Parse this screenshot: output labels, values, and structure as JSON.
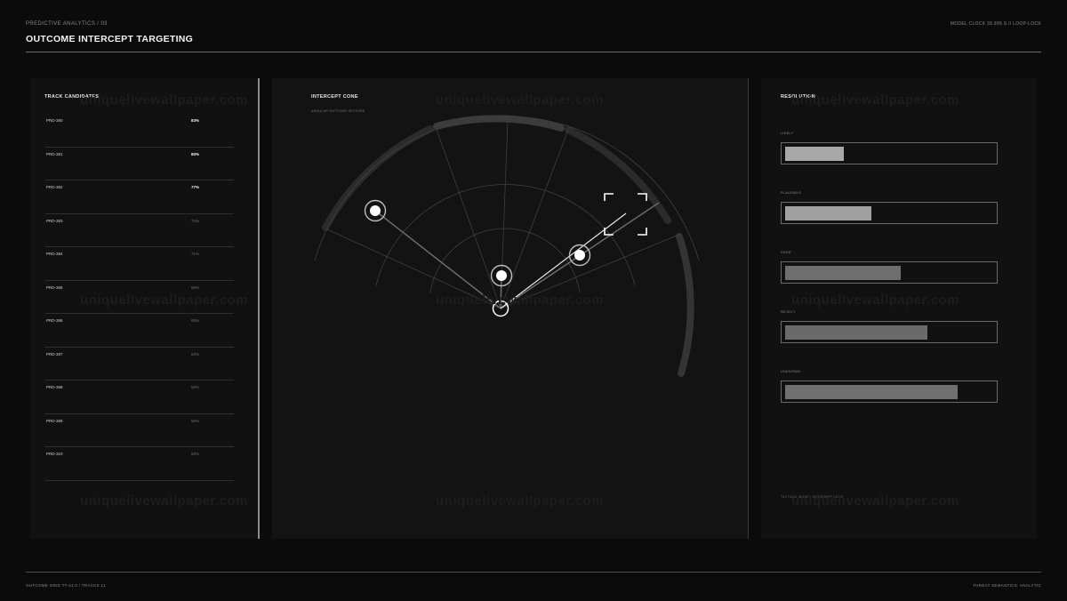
{
  "header": {
    "kicker": "PREDICTIVE ANALYTICS / 03",
    "title": "OUTCOME INTERCEPT TARGETING",
    "clock": "MODEL CLOCK 39.995 S // LOOP-LOCK"
  },
  "footer": {
    "left": "OUTCOME GRID  TT-41.0  /  TRACKS 11",
    "right": "THREAT SEMANTICS: ANALYTIC"
  },
  "tracks": {
    "title": "TRACK CANDIDATES",
    "items": [
      {
        "id": "PRD-380",
        "value": "83%",
        "highlight": true
      },
      {
        "id": "PRD-381",
        "value": "80%",
        "highlight": true
      },
      {
        "id": "PRD-382",
        "value": "77%",
        "highlight": true
      },
      {
        "id": "PRD-383",
        "value": "74%",
        "highlight": false
      },
      {
        "id": "PRD-384",
        "value": "71%",
        "highlight": false
      },
      {
        "id": "PRD-385",
        "value": "68%",
        "highlight": false
      },
      {
        "id": "PRD-386",
        "value": "65%",
        "highlight": false
      },
      {
        "id": "PRD-387",
        "value": "62%",
        "highlight": false
      },
      {
        "id": "PRD-388",
        "value": "59%",
        "highlight": false
      },
      {
        "id": "PRD-389",
        "value": "56%",
        "highlight": false
      },
      {
        "id": "PRD-310",
        "value": "53%",
        "highlight": false
      }
    ]
  },
  "cone": {
    "title": "INTERCEPT CONE",
    "subtitle": "ANGULAR OUTCOME SECTORS"
  },
  "resolution": {
    "title": "RESOLUTION",
    "items": [
      {
        "label": "LIKELY",
        "fill": 0.28,
        "color": "#a8a8a8"
      },
      {
        "label": "PLAUSIBLE",
        "fill": 0.41,
        "color": "#a0a0a0"
      },
      {
        "label": "EDGE",
        "fill": 0.55,
        "color": "#6e6e6e"
      },
      {
        "label": "REJECT",
        "fill": 0.68,
        "color": "#6a6a6a"
      },
      {
        "label": "UNKNOWN",
        "fill": 0.82,
        "color": "#707070"
      }
    ],
    "note": "TACTICAL MODE / INTERCEPT LOCK"
  },
  "watermark": "uniquelivewallpaper.com",
  "colors": {
    "background": "#0a0b0a",
    "panel": "#101110",
    "accent": "#ffffff"
  }
}
